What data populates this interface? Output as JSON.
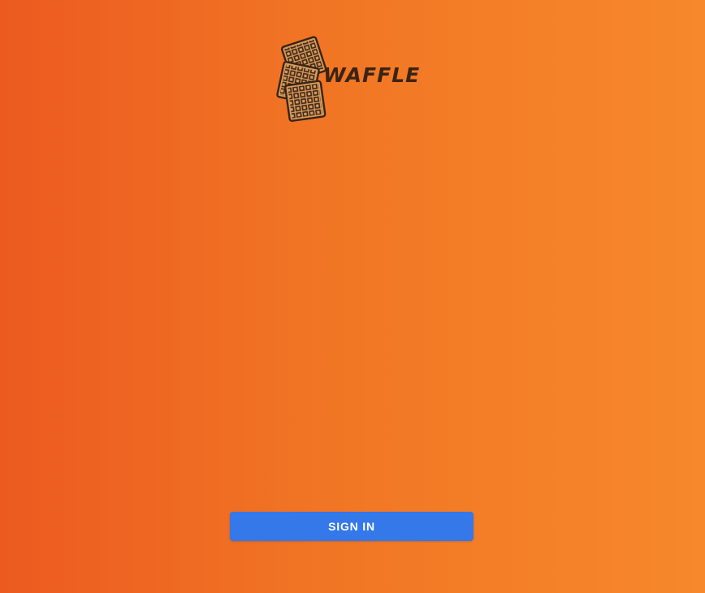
{
  "app": {
    "logo_text": "WAFFLE",
    "logo_icon": "waffle-stack-icon"
  },
  "actions": {
    "sign_in_label": "SIGN IN"
  },
  "colors": {
    "background_start": "#ec5a20",
    "background_end": "#f7882b",
    "button": "#3478ea",
    "logo_fill": "#d89b5c",
    "logo_stroke": "#3a2415"
  }
}
